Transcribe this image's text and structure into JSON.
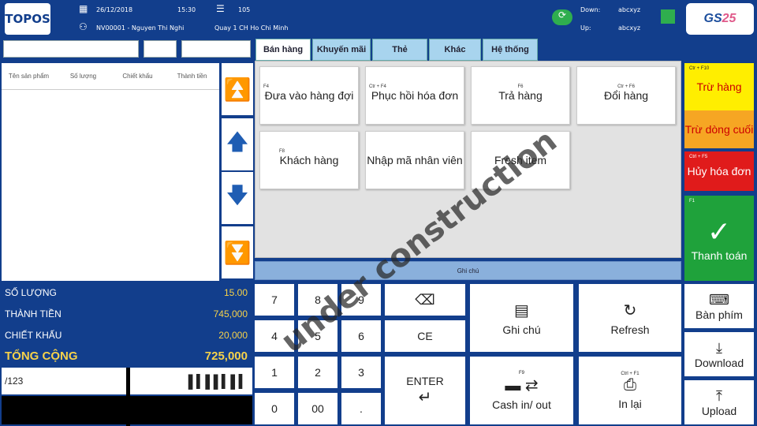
{
  "header": {
    "logo": "TOPOS",
    "date": "26/12/2018",
    "time": "15:30",
    "counter": "105",
    "employee": "NV00001 - Nguyen Thi Nghi",
    "counter_name": "Quay 1 CH Ho Chi Minh",
    "down_label": "Down:",
    "down_value": "abcxyz",
    "up_label": "Up:",
    "up_value": "abcxyz",
    "brand_logo_main": "GS",
    "brand_logo_num": "25"
  },
  "list": {
    "columns": [
      "Tên sản phẩm",
      "Số lượng",
      "Chiết khấu",
      "Thành tiền"
    ]
  },
  "totals": {
    "qty_label": "SỐ LƯỢNG",
    "qty_value": "15.00",
    "amount_label": "THÀNH TIỀN",
    "amount_value": "745,000",
    "discount_label": "CHIẾT KHẤU",
    "discount_value": "20,000",
    "grand_label": "TỔNG CỘNG",
    "grand_value": "725,000"
  },
  "barcode": {
    "input_value": "/123"
  },
  "tabs": [
    "Bán hàng",
    "Khuyến mãi",
    "Thẻ",
    "Khác",
    "Hệ thống"
  ],
  "functions": [
    {
      "key": "F4",
      "label": "Đưa vào hàng đợi"
    },
    {
      "key": "Ctr + F4",
      "label": "Phục hồi hóa đơn"
    },
    {
      "key": "F6",
      "label": "Trả hàng"
    },
    {
      "key": "Ctr + F6",
      "label": "Đổi hàng"
    },
    {
      "key": "F8",
      "label": "Khách hàng"
    },
    {
      "key": "",
      "label": "Nhập mã nhân viên"
    },
    {
      "key": "",
      "label": "Fresh item"
    }
  ],
  "note_bar": "Ghi chú",
  "keypad": [
    "7",
    "8",
    "9",
    "4",
    "5",
    "6",
    "1",
    "2",
    "3",
    "0",
    "00",
    "."
  ],
  "keys": {
    "ce": "CE",
    "enter": "ENTER",
    "ghi_chu": "Ghi chú",
    "refresh": "Refresh",
    "cash_key": "F9",
    "cash": "Cash in/ out",
    "print_key": "Ctrl + F1",
    "print": "In lại"
  },
  "right": {
    "tru_hang_key": "Ctr + F10",
    "tru_hang": "Trừ hàng",
    "tru_dong": "Trừ dòng cuối",
    "huy_key": "Ctrl + F5",
    "huy": "Hủy hóa đơn",
    "pay_key": "F1",
    "pay": "Thanh toán",
    "keyboard": "Bàn phím",
    "download": "Download",
    "upload": "Upload"
  },
  "watermark": "under construction"
}
